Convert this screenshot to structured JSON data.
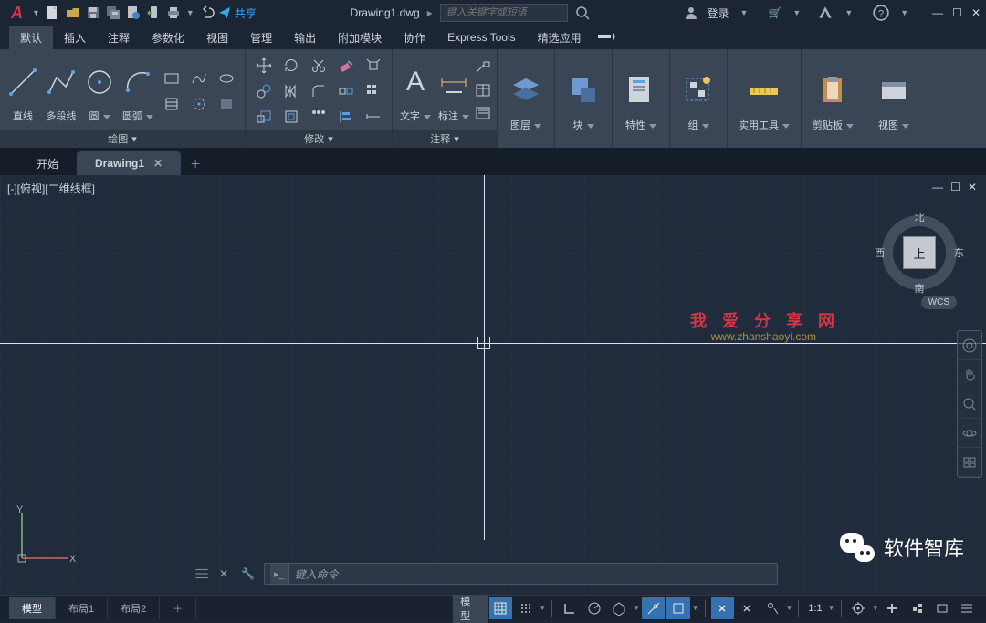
{
  "title": {
    "filename": "Drawing1.dwg",
    "share": "共享",
    "search_placeholder": "键入关键字或短语",
    "login": "登录"
  },
  "ribbon_tabs": [
    "默认",
    "插入",
    "注释",
    "参数化",
    "视图",
    "管理",
    "输出",
    "附加模块",
    "协作",
    "Express Tools",
    "精选应用"
  ],
  "panels": {
    "draw": {
      "label": "绘图",
      "line": "直线",
      "pline": "多段线",
      "circle": "圆",
      "arc": "圆弧"
    },
    "modify": {
      "label": "修改"
    },
    "annot": {
      "label": "注释",
      "text": "文字",
      "dim": "标注"
    },
    "layers": "图层",
    "blocks": "块",
    "props": "特性",
    "groups": "组",
    "util": "实用工具",
    "clip": "剪贴板",
    "view": "视图"
  },
  "file_tabs": {
    "start": "开始",
    "active": "Drawing1"
  },
  "viewport": {
    "label": "[-][俯视][二维线框]",
    "wcs": "WCS",
    "cube": {
      "face": "上",
      "n": "北",
      "s": "南",
      "w": "西",
      "e": "东"
    }
  },
  "watermark": {
    "line1": "我 爱 分 享 网",
    "line2": "www.zhanshaoyi.com"
  },
  "cmd": {
    "placeholder": "键入命令"
  },
  "wechat_label": "软件智库",
  "layout_tabs": {
    "model": "模型",
    "l1": "布局1",
    "l2": "布局2"
  },
  "status": {
    "model": "模型",
    "scale": "1:1"
  }
}
